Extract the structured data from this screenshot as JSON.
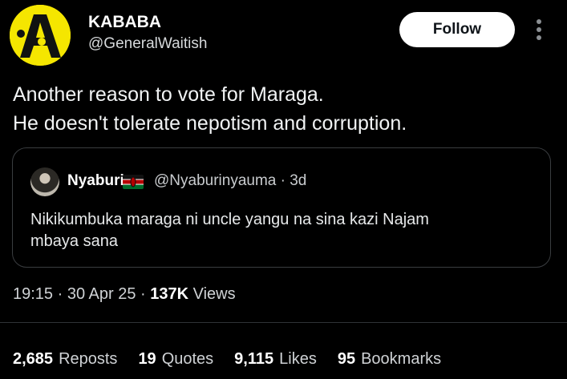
{
  "author": {
    "display_name": "KABABA",
    "handle": "@GeneralWaitish",
    "avatar_color": "#f5e600"
  },
  "follow_label": "Follow",
  "more_icon": "vertical-ellipsis-icon",
  "tweet": {
    "text": "Another reason to vote for Maraga.\nHe doesn't tolerate nepotism and corruption."
  },
  "quote": {
    "name": "Nyaburi",
    "flag": "kenya-flag-icon",
    "meta": "@Nyaburinyauma · 3d",
    "text": "Nikikumbuka maraga ni uncle  yangu na sina kazi Najam\nmbaya sana"
  },
  "meta": {
    "time": "19:15",
    "sep1": " · ",
    "date": "30 Apr 25",
    "sep2": " · ",
    "views_count": "137K",
    "views_label": " Views"
  },
  "stats": [
    {
      "count": "2,685",
      "label": "Reposts"
    },
    {
      "count": "19",
      "label": "Quotes"
    },
    {
      "count": "9,115",
      "label": "Likes"
    },
    {
      "count": "95",
      "label": "Bookmarks"
    }
  ]
}
